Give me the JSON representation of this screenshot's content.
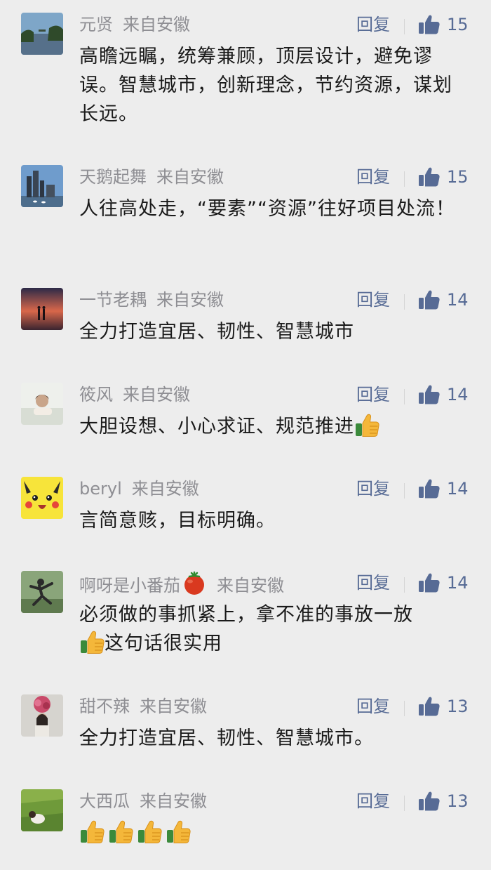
{
  "source_label": "来自安徽",
  "reply_label": "回复",
  "colors": {
    "background": "#ededed",
    "link_blue": "#576b95",
    "meta_gray": "#8e8e93",
    "text": "#1a1a1a"
  },
  "comments": [
    {
      "name": "元贤",
      "text": "高瞻远瞩，统筹兼顾，顶层设计，避免谬误。智慧城市，创新理念，节约资源，谋划长远。",
      "likes": "15",
      "avatar": "city-lake-photo"
    },
    {
      "name": "天鹅起舞",
      "text": "人往高处走，“要素”“资源”往好项目处流！",
      "likes": "15",
      "avatar": "skyline-swans-photo"
    },
    {
      "name": "一节老耦",
      "text": "全力打造宜居、韧性、智慧城市",
      "likes": "14",
      "avatar": "sunset-couple-photo"
    },
    {
      "name": "筱风",
      "text": "大胆设想、小心求证、规范推进",
      "emoji_suffix": 1,
      "likes": "14",
      "avatar": "woman-portrait-photo"
    },
    {
      "name": "beryl",
      "text": "言简意赅，目标明确。",
      "likes": "14",
      "avatar": "pikachu-image"
    },
    {
      "name": "啊呀是小番茄",
      "name_emoji": "tomato",
      "text_after_emoji_line1": "必须做的事抓紧上，拿不准的事放一放",
      "text_after_emoji_line2": "这句话很实用",
      "likes": "14",
      "avatar": "martial-arts-photo"
    },
    {
      "name": "甜不辣",
      "text": "全力打造宜居、韧性、智慧城市。",
      "likes": "13",
      "avatar": "flower-girl-photo"
    },
    {
      "name": "大西瓜",
      "text": "",
      "emoji_count": 4,
      "likes": "13",
      "avatar": "grass-field-photo"
    }
  ],
  "icons": {
    "like": "thumbs-up-icon",
    "emoji": "thumbs-up-emoji",
    "tomato": "tomato-emoji"
  }
}
